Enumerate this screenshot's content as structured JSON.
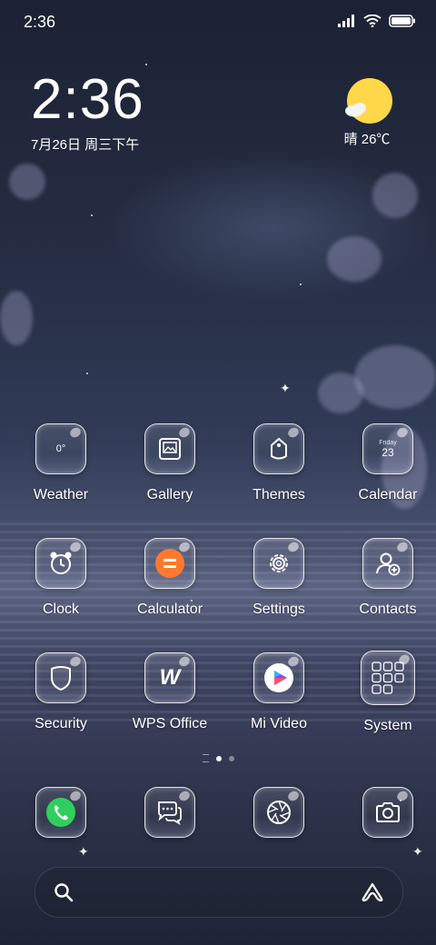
{
  "status_bar": {
    "time": "2:36"
  },
  "clock_widget": {
    "time": "2:36",
    "date": "7月26日 周三下午"
  },
  "weather_widget": {
    "text": "晴 26℃",
    "icon": "sunny-cloud-icon"
  },
  "apps": [
    [
      {
        "label": "Weather",
        "icon": "weather-icon",
        "glyph": "0°"
      },
      {
        "label": "Gallery",
        "icon": "gallery-icon"
      },
      {
        "label": "Themes",
        "icon": "themes-icon"
      },
      {
        "label": "Calendar",
        "icon": "calendar-icon",
        "day": "Friday",
        "date": "23"
      }
    ],
    [
      {
        "label": "Clock",
        "icon": "alarm-clock-icon"
      },
      {
        "label": "Calculator",
        "icon": "calculator-icon"
      },
      {
        "label": "Settings",
        "icon": "settings-gear-icon"
      },
      {
        "label": "Contacts",
        "icon": "contacts-icon"
      }
    ],
    [
      {
        "label": "Security",
        "icon": "security-shield-icon"
      },
      {
        "label": "WPS Office",
        "icon": "wps-office-icon",
        "glyph": "W"
      },
      {
        "label": "Mi Video",
        "icon": "mi-video-icon"
      },
      {
        "label": "System",
        "icon": "system-folder-icon"
      }
    ]
  ],
  "dock": [
    {
      "name": "phone",
      "icon": "phone-icon"
    },
    {
      "name": "messages",
      "icon": "messages-icon"
    },
    {
      "name": "browser",
      "icon": "browser-shutter-icon"
    },
    {
      "name": "camera",
      "icon": "camera-icon"
    }
  ],
  "page_indicator": {
    "pages": 2,
    "current": 1
  },
  "colors": {
    "calculator": "#ff7a2e",
    "phone": "#2fcf5f",
    "sun": "#ffd84a"
  }
}
